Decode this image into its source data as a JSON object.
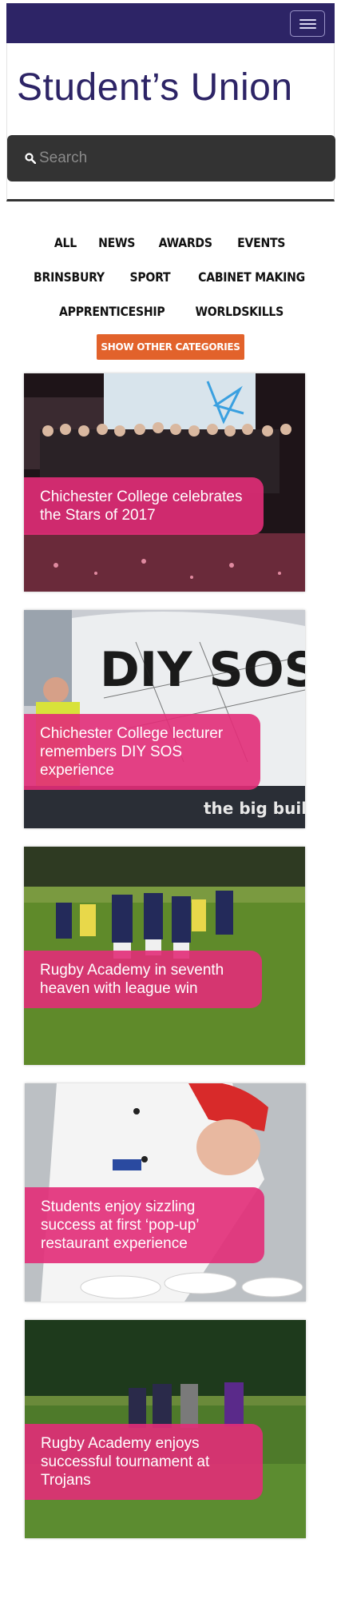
{
  "header": {
    "site_title": "Student’s Union",
    "search_placeholder": "Search"
  },
  "categories": {
    "rows": [
      [
        "ALL",
        "NEWS",
        "AWARDS",
        "EVENTS"
      ],
      [
        "BRINSBURY",
        "SPORT",
        "CABINET MAKING"
      ],
      [
        "APPRENTICESHIP",
        "WORLDSKILLS"
      ]
    ],
    "more_button": "SHOW OTHER CATEGORIES"
  },
  "articles": [
    {
      "title": "Chichester College celebrates the Stars of 2017"
    },
    {
      "title": "Chichester College lecturer remembers DIY SOS experience"
    },
    {
      "title": "Rugby Academy in seventh heaven with league win"
    },
    {
      "title": "Students enjoy sizzling success at first ‘pop-up’ restaurant experience"
    },
    {
      "title": "Rugby Academy enjoys successful tournament at Trojans"
    }
  ],
  "colors": {
    "brand": "#2d2466",
    "accent": "#e2622b",
    "card_label": "#e22c78"
  }
}
